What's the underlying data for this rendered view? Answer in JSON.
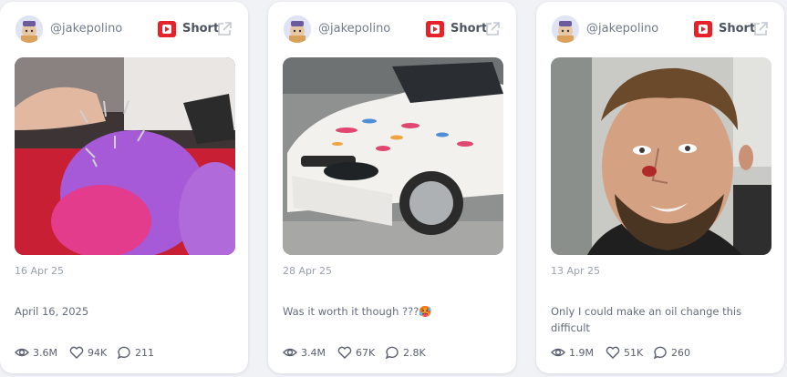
{
  "colors": {
    "brand_red": "#e4232a",
    "text_muted": "#9aa0ad",
    "card_bg": "#ffffff",
    "page_bg": "#f1f2f6"
  },
  "cards": [
    {
      "handle": "@jakepolino",
      "platform_label": "Short",
      "date": "16 Apr 25",
      "caption": "April 16, 2025",
      "views": "3.6M",
      "likes": "94K",
      "comments": "211"
    },
    {
      "handle": "@jakepolino",
      "platform_label": "Short",
      "date": "28 Apr 25",
      "caption": "Was it worth it though ???🥵",
      "views": "3.4M",
      "likes": "67K",
      "comments": "2.8K"
    },
    {
      "handle": "@jakepolino",
      "platform_label": "Short",
      "date": "13 Apr 25",
      "caption": "Only I could make an oil change this difficult",
      "views": "1.9M",
      "likes": "51K",
      "comments": "260"
    }
  ],
  "icons": {
    "platform": "youtube-icon",
    "open": "external-link-icon",
    "views": "eye-icon",
    "likes": "heart-icon",
    "comments": "comment-icon"
  }
}
